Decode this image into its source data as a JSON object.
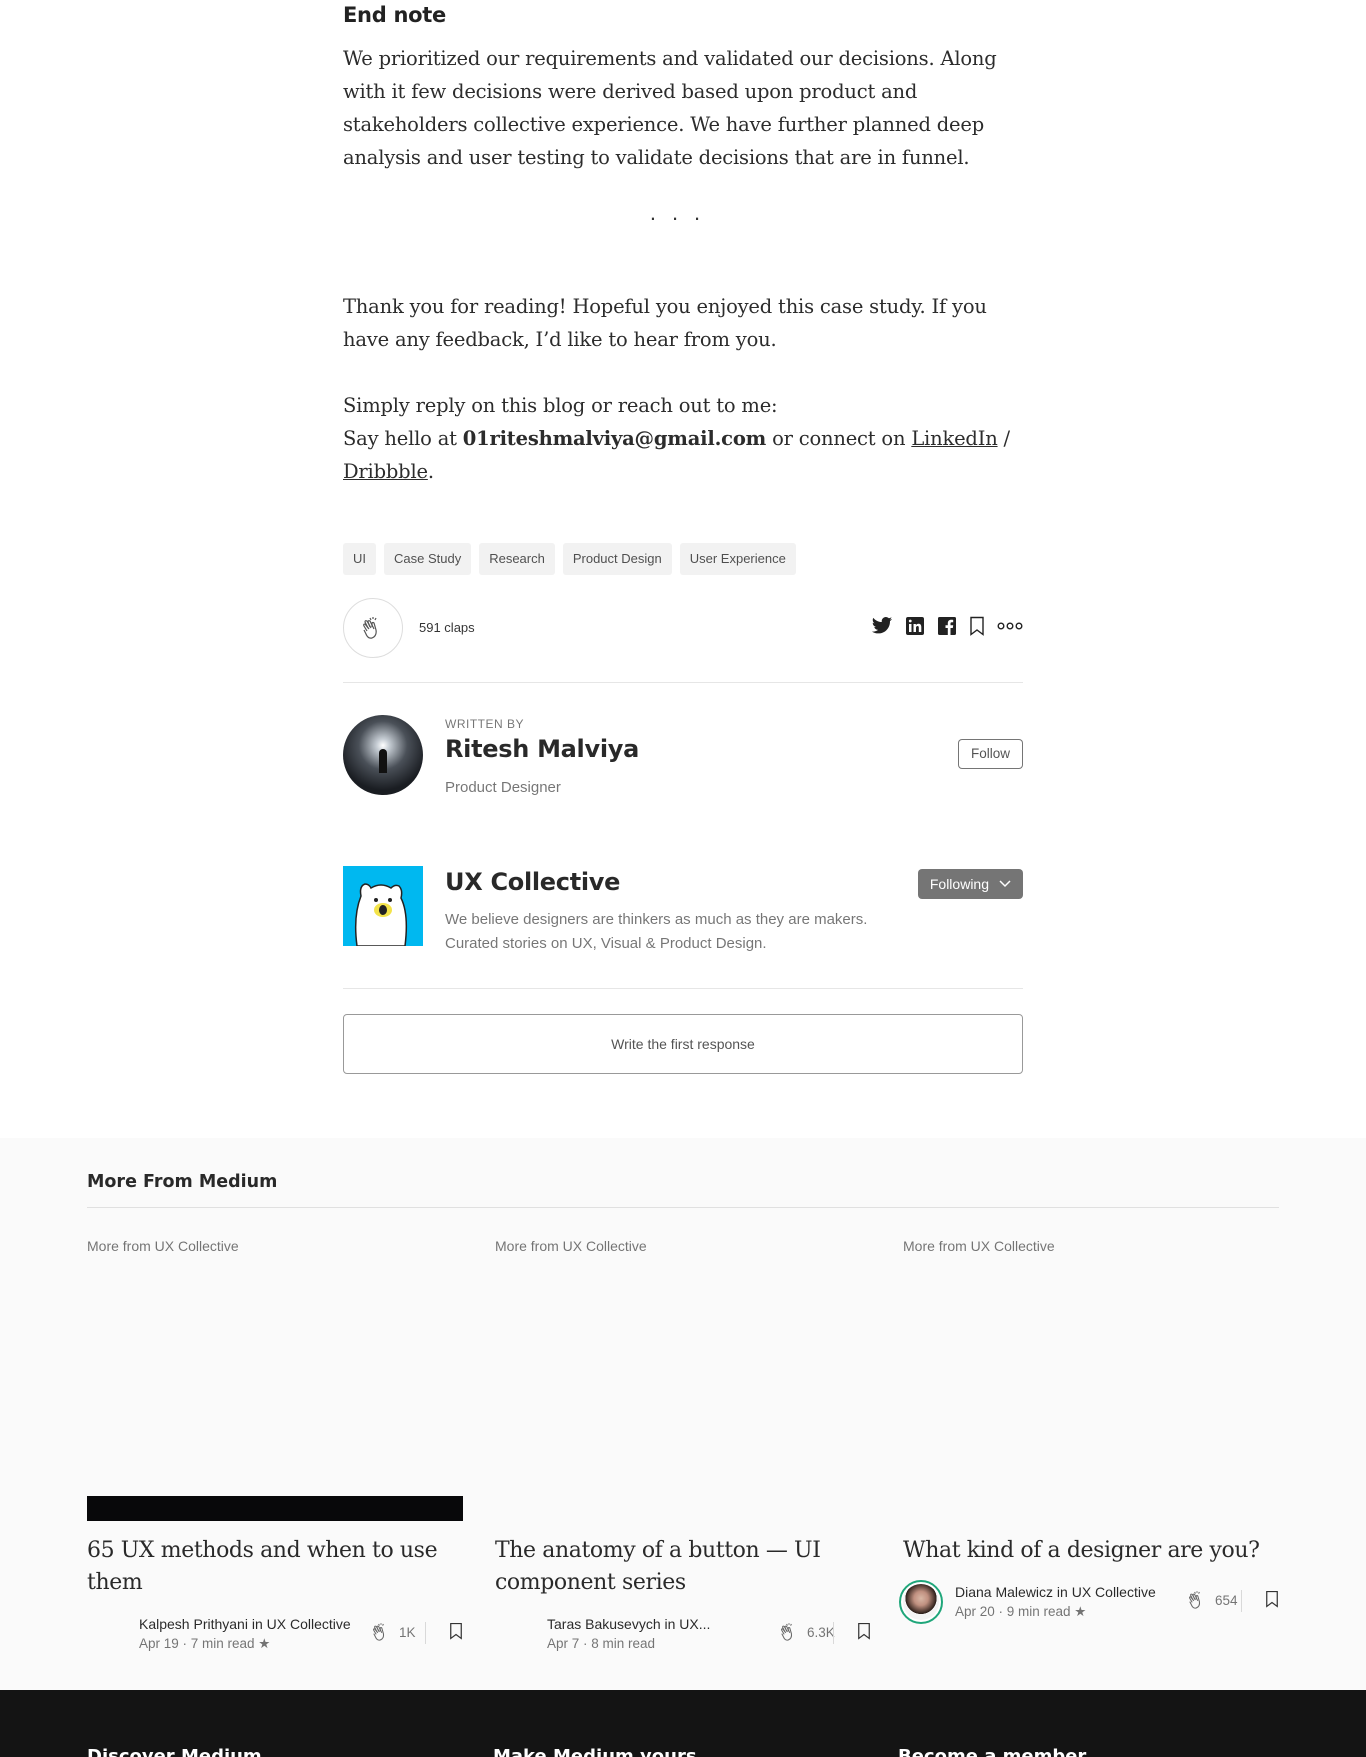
{
  "article": {
    "end_note_heading": "End note",
    "end_note_text": "We prioritized our requirements and validated our decisions. Along with it few decisions were derived based upon product and stakeholders collective experience. We have further planned deep analysis and user testing to validate decisions that are in funnel.",
    "separator": "...",
    "thanks_text": "Thank you for reading! Hopeful you enjoyed this case study. If you have any feedback, I’d like to hear from you.",
    "reply_text": "Simply reply on this blog or reach out to me:",
    "say_hello": "Say hello at ",
    "email": "01riteshmalviya@gmail.com",
    "connect_text": " or connect on ",
    "linkedin_link": "LinkedIn",
    "slash": " /",
    "dribbble_link": "Dribbble",
    "period": "."
  },
  "tags": [
    "UI",
    "Case Study",
    "Research",
    "Product Design",
    "User Experience"
  ],
  "claps": {
    "count_label": "591 claps"
  },
  "share_icons": [
    "twitter-icon",
    "linkedin-icon",
    "facebook-icon",
    "bookmark-icon",
    "more-icon"
  ],
  "author": {
    "written_by": "WRITTEN BY",
    "name": "Ritesh Malviya",
    "bio": "Product Designer",
    "follow_label": "Follow"
  },
  "publication": {
    "name": "UX Collective",
    "description_line1": "We believe designers are thinkers as much as they are makers.",
    "description_line2": "Curated stories on UX, Visual & Product Design.",
    "following_label": "Following",
    "logo_color": "#00b8f0"
  },
  "response": {
    "label": "Write the first response"
  },
  "more_from_medium": {
    "heading": "More From Medium",
    "cards": [
      {
        "kicker": "More from UX Collective",
        "title": "65 UX methods and when to use them",
        "author": "Kalpesh Prithyani in UX Collective",
        "date": "Apr 19 · 7 min read ★",
        "claps": "1K"
      },
      {
        "kicker": "More from UX Collective",
        "title": "The anatomy of a button — UI component series",
        "author": "Taras Bakusevych in UX...",
        "date": "Apr 7 · 8 min read",
        "claps": "6.3K"
      },
      {
        "kicker": "More from UX Collective",
        "title": "What kind of a designer are you?",
        "author": "Diana Malewicz in UX Collective",
        "date": "Apr 20 · 9 min read ★",
        "claps": "654"
      }
    ]
  },
  "footer": {
    "col1": "Discover Medium",
    "col2": "Make Medium yours",
    "col3": "Become a member"
  }
}
